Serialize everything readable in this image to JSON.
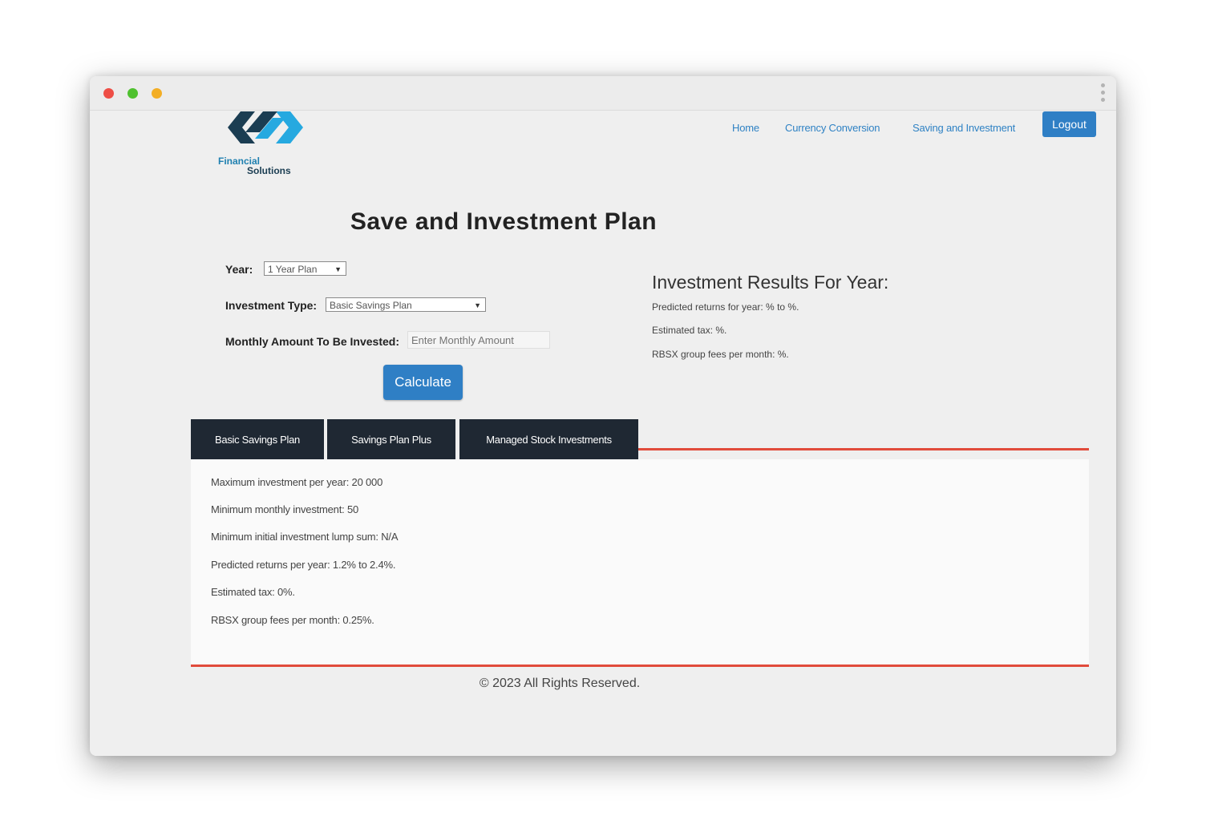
{
  "brand": {
    "line1": "Financial",
    "line2": "Solutions"
  },
  "nav": {
    "items": [
      {
        "label": "Home"
      },
      {
        "label": "Currency Conversion"
      },
      {
        "label": "Saving and Investment"
      }
    ],
    "logout_label": "Logout"
  },
  "page_title": "Save and Investment Plan",
  "form": {
    "year_label": "Year:",
    "year_value": "1 Year Plan",
    "type_label": "Investment Type:",
    "type_value": "Basic Savings Plan",
    "amount_label": "Monthly Amount To Be Invested:",
    "amount_placeholder": "Enter Monthly Amount",
    "amount_value": "",
    "calculate_label": "Calculate"
  },
  "results": {
    "title": "Investment Results For Year:",
    "lines": [
      "Predicted returns for year: % to %.",
      "Estimated tax: %.",
      "RBSX group fees per month: %."
    ]
  },
  "tabs": [
    {
      "label": "Basic Savings Plan"
    },
    {
      "label": "Savings Plan Plus"
    },
    {
      "label": "Managed Stock Investments"
    }
  ],
  "active_plan": {
    "lines": [
      "Maximum investment per year: 20 000",
      "Minimum monthly investment: 50",
      "Minimum initial investment lump sum: N/A",
      "Predicted returns per year: 1.2% to 2.4%.",
      "Estimated tax: 0%.",
      "RBSX group fees per month: 0.25%."
    ]
  },
  "footer": "© 2023 All Rights Reserved.",
  "colors": {
    "accent_blue": "#2f7fc5",
    "tab_dark": "#1f2833",
    "accent_red": "#e14b3b"
  }
}
